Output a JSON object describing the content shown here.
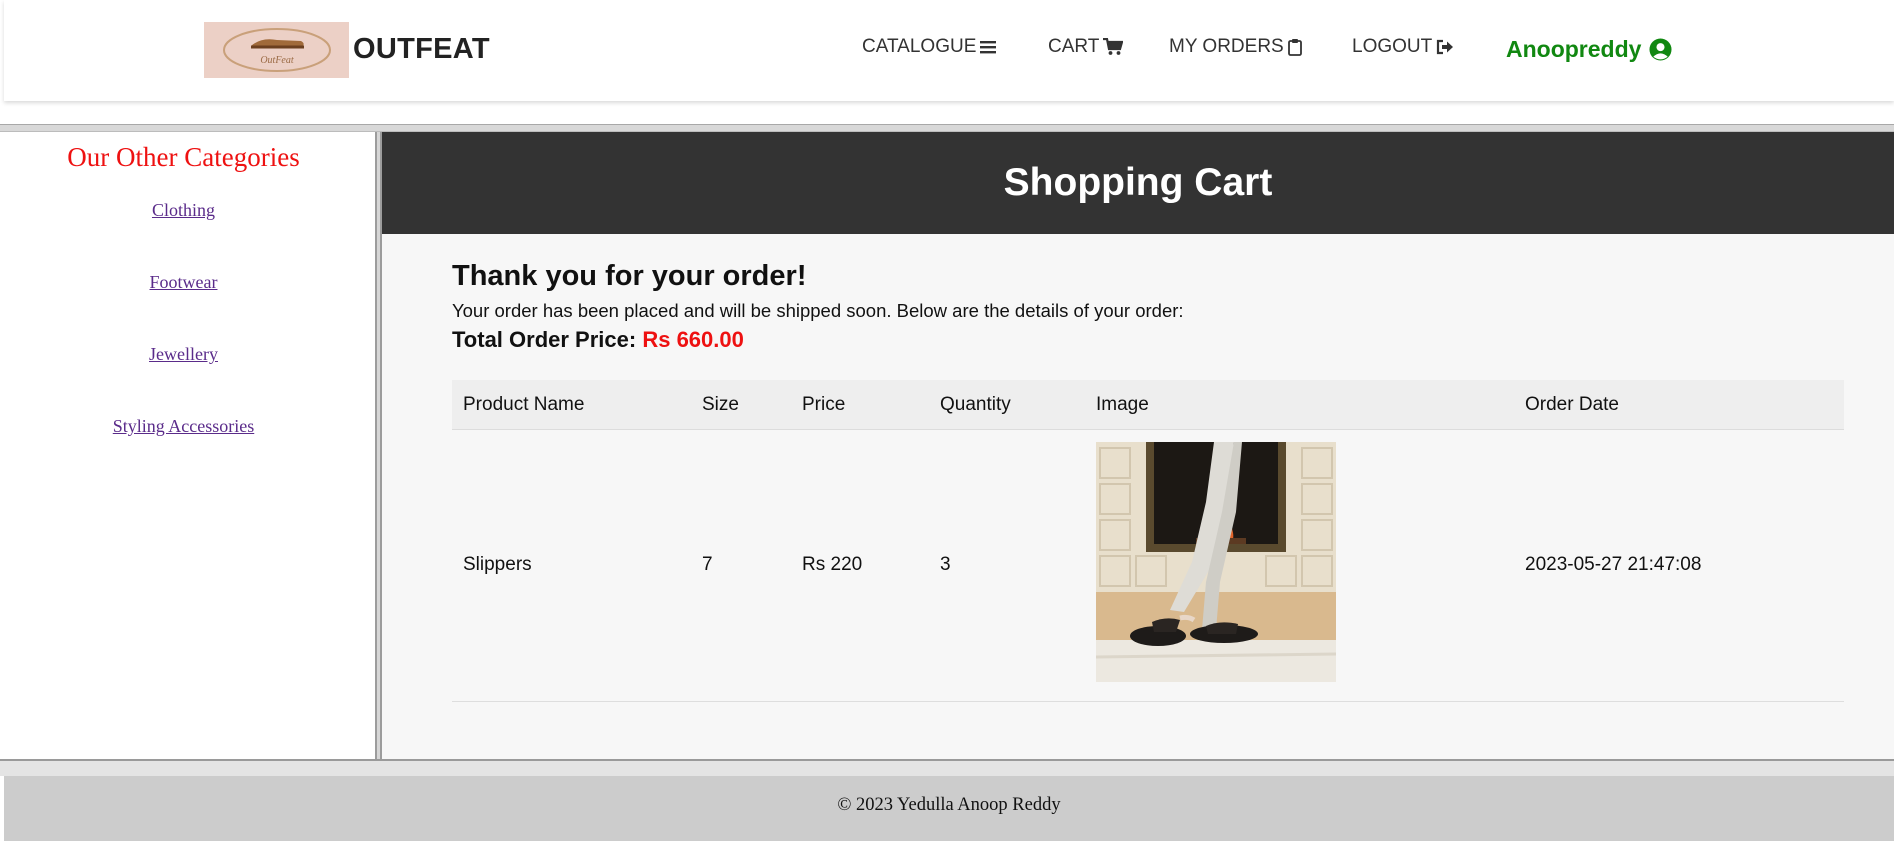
{
  "header": {
    "logo_text": "OutFeat",
    "brand": "OUTFEAT",
    "nav": [
      {
        "label": "CATALOGUE",
        "icon": "bars-icon"
      },
      {
        "label": "CART",
        "icon": "shopping-cart-icon"
      },
      {
        "label": "MY ORDERS",
        "icon": "clipboard-icon"
      },
      {
        "label": "LOGOUT",
        "icon": "sign-out-icon"
      }
    ],
    "user": {
      "name": "Anoopreddy",
      "icon": "user-circle-icon",
      "color": "#118811"
    }
  },
  "sidebar": {
    "title": "Our Other Categories",
    "links": [
      "Clothing",
      "Footwear",
      "Jewellery",
      "Styling Accessories"
    ],
    "title_color": "#ee1111",
    "link_color": "#5a2b8a"
  },
  "main": {
    "heading": "Shopping Cart",
    "thanks": "Thank you for your order!",
    "description": "Your order has been placed and will be shipped soon. Below are the details of your order:",
    "total_label": "Total Order Price:",
    "total_value": "Rs 660.00",
    "table": {
      "headers": [
        "Product Name",
        "Size",
        "Price",
        "Quantity",
        "Image",
        "Order Date"
      ],
      "rows": [
        {
          "product": "Slippers",
          "size": "7",
          "price": "Rs 220",
          "quantity": "3",
          "image": "slippers-photo",
          "date": "2023-05-27 21:47:08"
        }
      ]
    }
  },
  "footer": {
    "text": "© 2023 Yedulla Anoop Reddy"
  }
}
